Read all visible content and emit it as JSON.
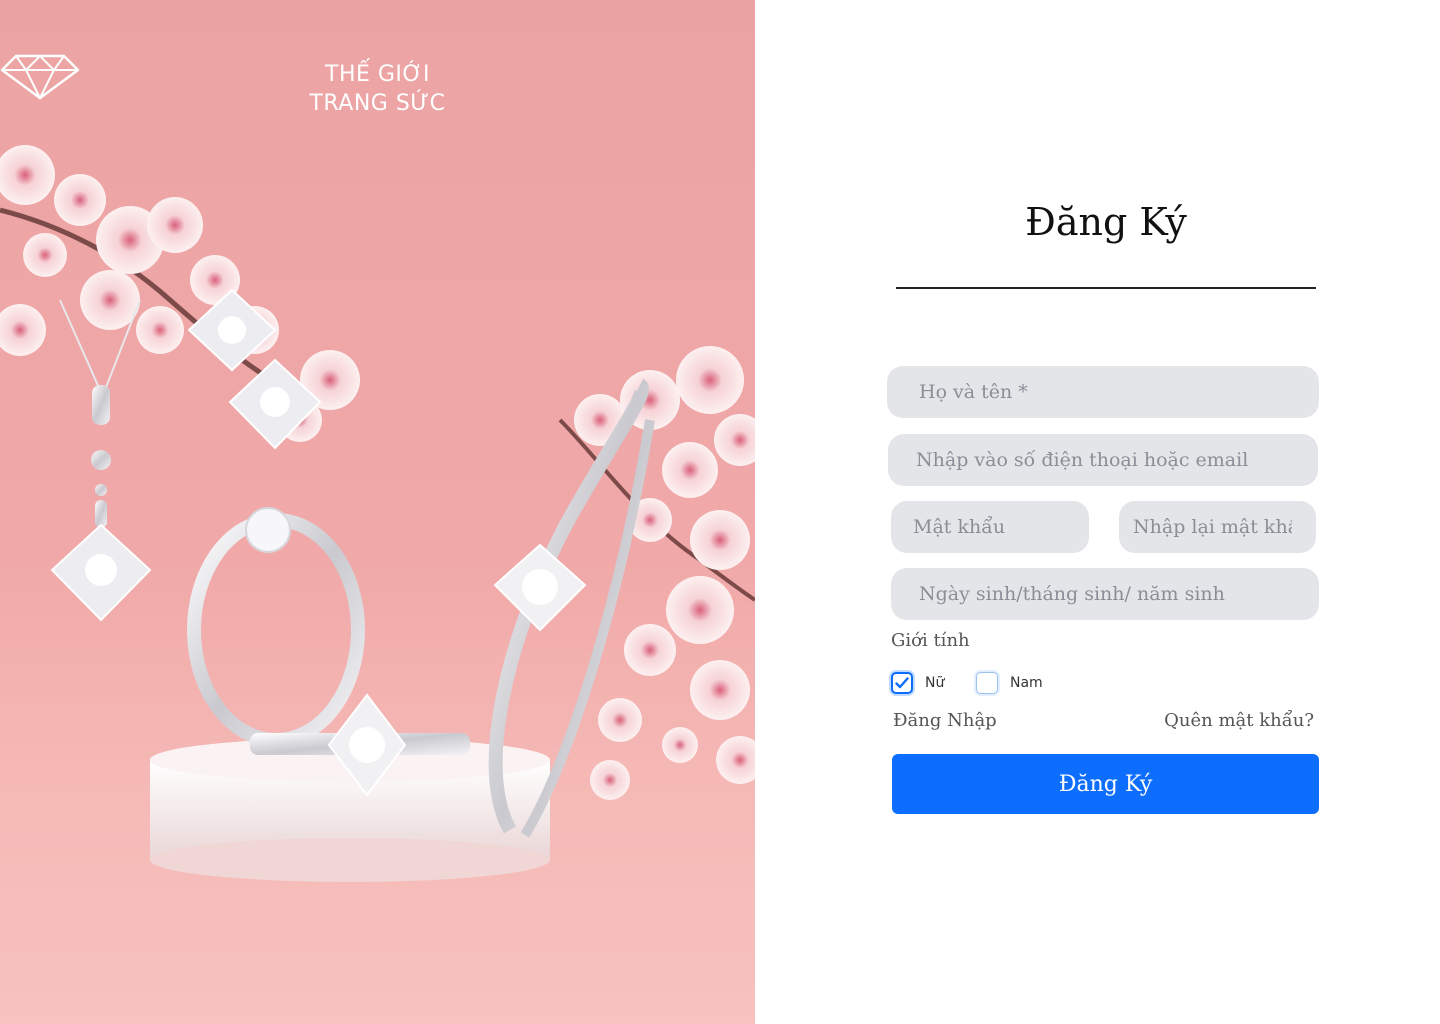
{
  "brand": {
    "line1": "THẾ GIỚI",
    "line2": "TRANG SỨC"
  },
  "form": {
    "title": "Đăng Ký",
    "full_name_placeholder": "Họ và tên *",
    "contact_placeholder": "Nhập vào số điện thoại hoặc email",
    "password_placeholder": "Mật khẩu",
    "confirm_password_placeholder": "Nhập lại mật khẩu",
    "dob_placeholder": "Ngày sinh/tháng sinh/ năm sinh",
    "gender_label": "Giới tính",
    "gender_options": [
      {
        "label": "Nữ",
        "checked": true
      },
      {
        "label": "Nam",
        "checked": false
      }
    ],
    "login_link": "Đăng Nhập",
    "forgot_link": "Quên mật khẩu?",
    "submit_label": "Đăng Ký"
  },
  "colors": {
    "accent": "#0d6efd",
    "hero_pink": "#eba3a3",
    "field_bg": "#e3e5e9"
  }
}
